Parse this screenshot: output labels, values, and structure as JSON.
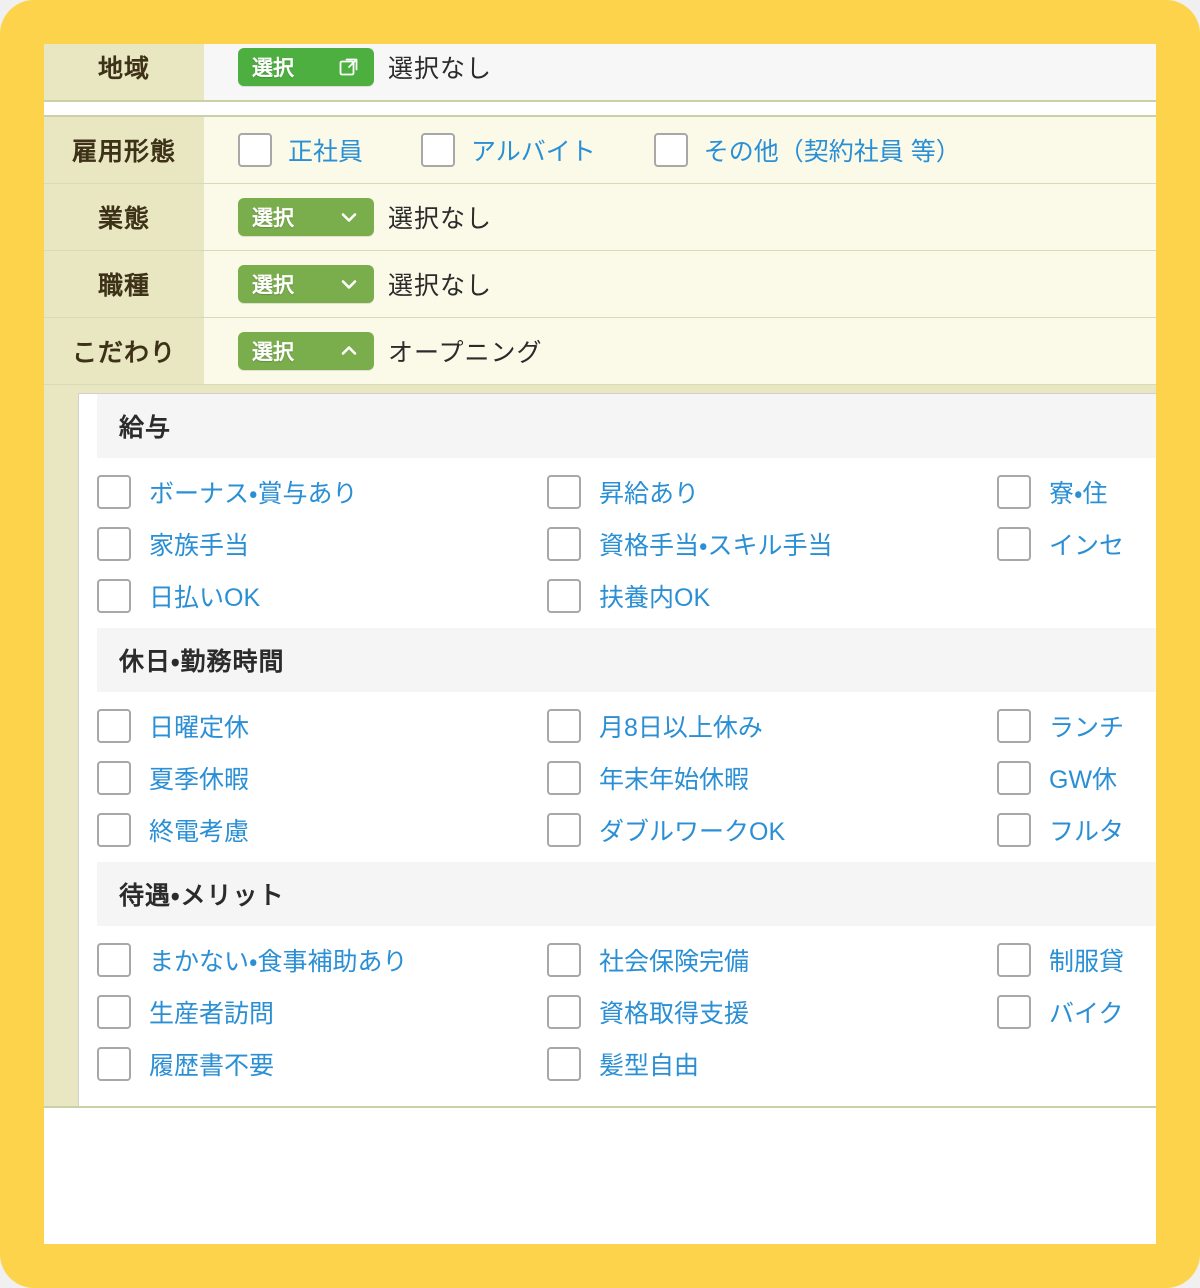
{
  "theme": {
    "frame_color": "#fcd34a",
    "label_bg": "#e9e7c1",
    "value_bg": "#fbfae8",
    "button_green": "#7aad4c",
    "button_green_bright": "#4caf3f",
    "link_blue": "#2a8fd4",
    "section_head_bg": "#f5f5f5"
  },
  "conditions": {
    "area": {
      "label": "地域",
      "button_label": "選択",
      "button_icon": "external-link-icon",
      "selected_text": "選択なし"
    },
    "employment_type": {
      "label": "雇用形態",
      "options": [
        {
          "label": "正社員",
          "checked": false
        },
        {
          "label": "アルバイト",
          "checked": false
        },
        {
          "label": "その他（契約社員 等）",
          "checked": false
        }
      ]
    },
    "business_type": {
      "label": "業態",
      "button_label": "選択",
      "button_icon": "chevron-down-icon",
      "selected_text": "選択なし"
    },
    "job_type": {
      "label": "職種",
      "button_label": "選択",
      "button_icon": "chevron-down-icon",
      "selected_text": "選択なし"
    },
    "kodawari": {
      "label": "こだわり",
      "button_label": "選択",
      "button_icon": "chevron-up-icon",
      "selected_text": "オープニング",
      "expanded": true
    }
  },
  "kodawari_panel": {
    "sections": [
      {
        "title": "給与",
        "items": [
          {
            "label": "ボーナス・賞与あり",
            "checked": false
          },
          {
            "label": "昇給あり",
            "checked": false
          },
          {
            "label": "寮・住",
            "checked": false
          },
          {
            "label": "家族手当",
            "checked": false
          },
          {
            "label": "資格手当・スキル手当",
            "checked": false
          },
          {
            "label": "インセ",
            "checked": false
          },
          {
            "label": "日払いOK",
            "checked": false
          },
          {
            "label": "扶養内OK",
            "checked": false
          },
          {
            "label": "",
            "checked": false
          }
        ]
      },
      {
        "title": "休日・勤務時間",
        "items": [
          {
            "label": "日曜定休",
            "checked": false
          },
          {
            "label": "月8日以上休み",
            "checked": false
          },
          {
            "label": "ランチ",
            "checked": false
          },
          {
            "label": "夏季休暇",
            "checked": false
          },
          {
            "label": "年末年始休暇",
            "checked": false
          },
          {
            "label": "GW休",
            "checked": false
          },
          {
            "label": "終電考慮",
            "checked": false
          },
          {
            "label": "ダブルワークOK",
            "checked": false
          },
          {
            "label": "フルタ",
            "checked": false
          }
        ]
      },
      {
        "title": "待遇・メリット",
        "items": [
          {
            "label": "まかない・食事補助あり",
            "checked": false
          },
          {
            "label": "社会保険完備",
            "checked": false
          },
          {
            "label": "制服貸",
            "checked": false
          },
          {
            "label": "生産者訪問",
            "checked": false
          },
          {
            "label": "資格取得支援",
            "checked": false
          },
          {
            "label": "バイク",
            "checked": false
          },
          {
            "label": "履歴書不要",
            "checked": false
          },
          {
            "label": "髪型自由",
            "checked": false
          },
          {
            "label": "",
            "checked": false
          }
        ]
      }
    ]
  }
}
